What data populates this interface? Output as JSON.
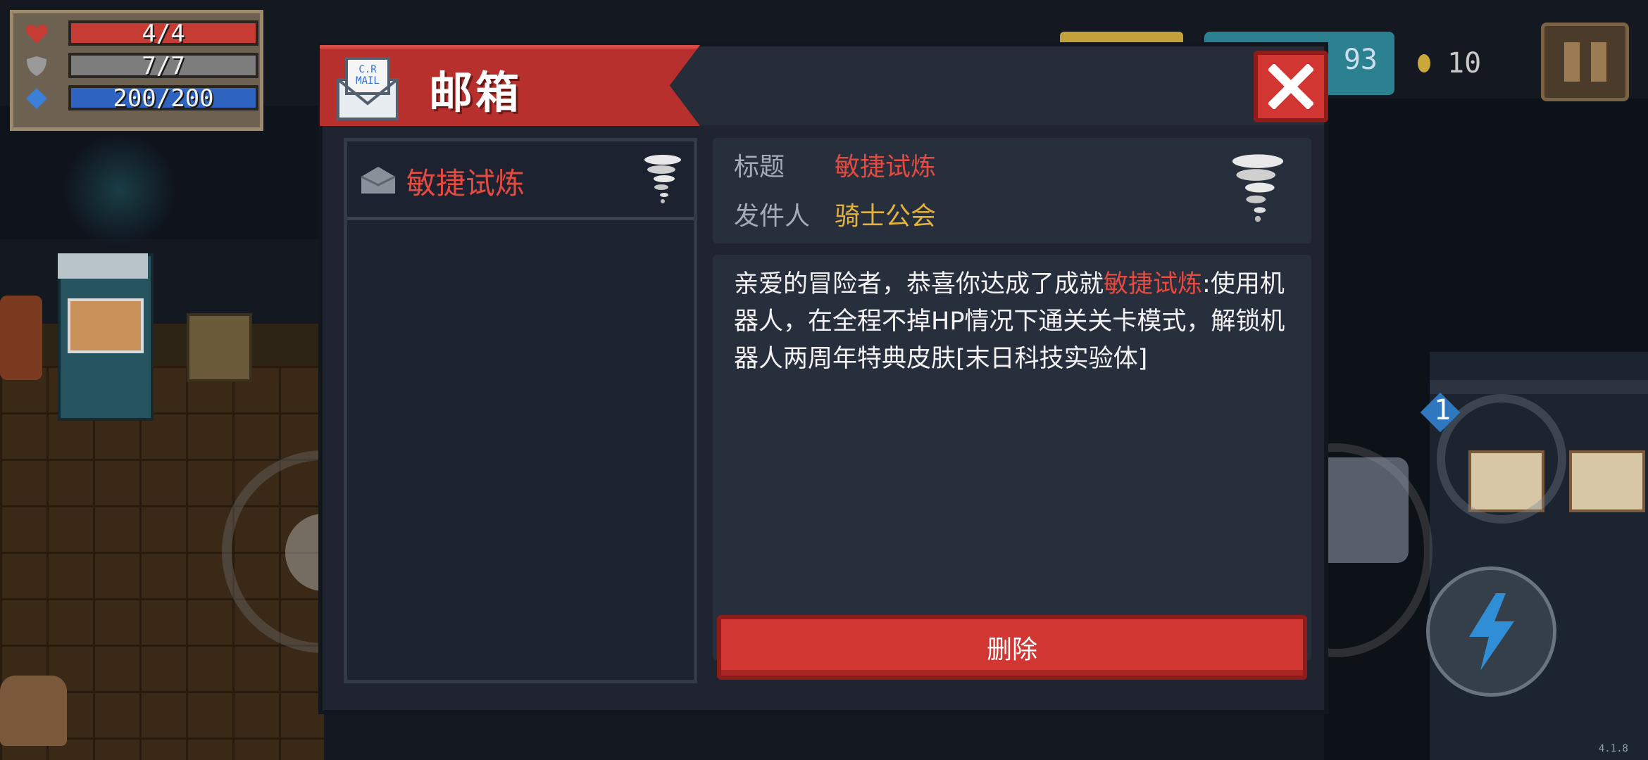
{
  "hud": {
    "hp": "4/4",
    "armor": "7/7",
    "energy": "200/200",
    "gems": "93",
    "coins": "10",
    "icons": [
      "heart-icon",
      "shield-icon",
      "energy-crystal-icon",
      "coin-icon",
      "pause-icon"
    ]
  },
  "mailbox": {
    "title": "邮箱",
    "list": [
      {
        "label": "敏捷试炼",
        "icon": "tornado-icon"
      }
    ],
    "detail": {
      "subject_label": "标题",
      "subject": "敏捷试炼",
      "sender_label": "发件人",
      "sender": "骑士公会",
      "body_prefix": "亲爱的冒险者，恭喜你达成了成就",
      "body_highlight": "敏捷试炼",
      "body_suffix": ":使用机器人，在全程不掉HP情况下通关关卡模式，解锁机器人两周年特典皮肤[末日科技实验体]"
    },
    "delete_label": "删除"
  },
  "skill_level": "1",
  "version": "4.1.8",
  "colors": {
    "accent_red": "#d23632",
    "highlight_red": "#e54a40",
    "sender_gold": "#e3b23c",
    "panel": "#272e3c"
  }
}
